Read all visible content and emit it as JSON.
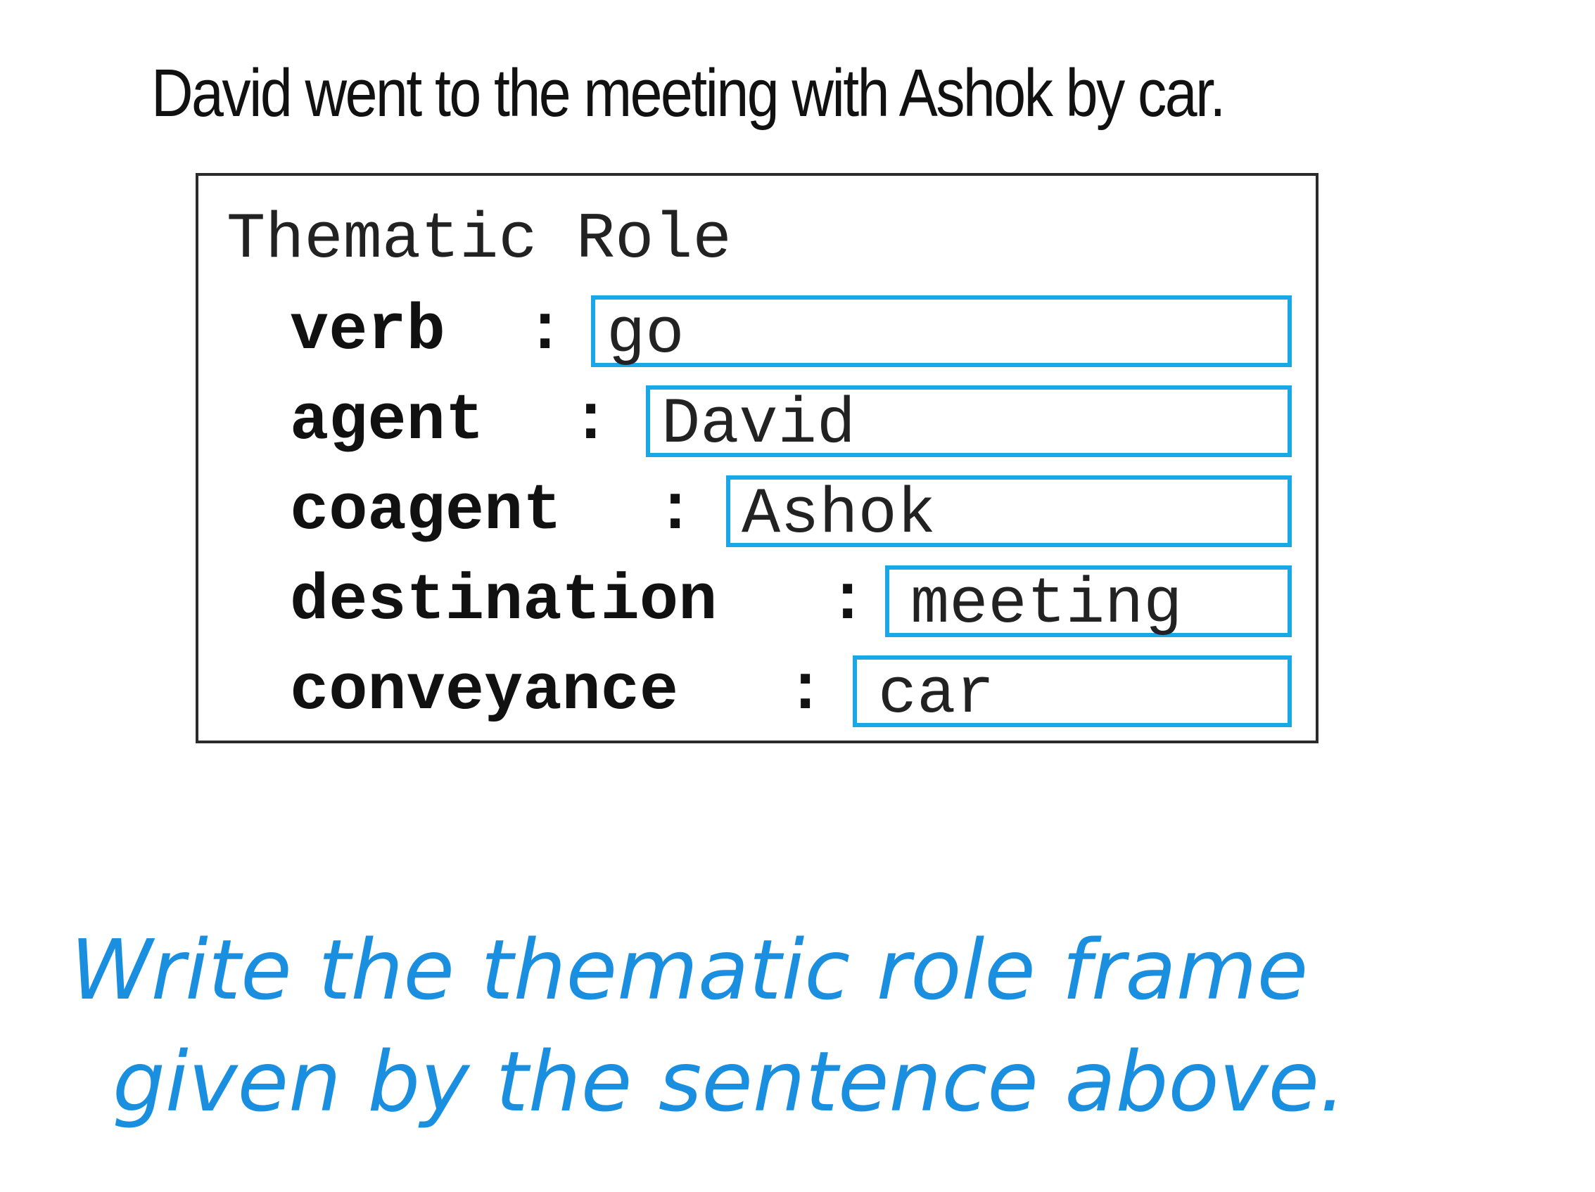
{
  "sentence": "David went to the meeting with Ashok by car.",
  "frame": {
    "title": "Thematic Role",
    "slots": [
      {
        "label": "verb",
        "value": "go"
      },
      {
        "label": "agent",
        "value": "David"
      },
      {
        "label": "coagent",
        "value": "Ashok"
      },
      {
        "label": "destination",
        "value": "meeting"
      },
      {
        "label": "conveyance",
        "value": "car"
      }
    ],
    "separator": ":"
  },
  "instruction": {
    "line1": "Write the thematic role frame",
    "line2": "given by the sentence above."
  },
  "colors": {
    "slot_border": "#1aa7e6",
    "instruction_text": "#1a8fe0",
    "frame_border": "#2b2b2b"
  }
}
